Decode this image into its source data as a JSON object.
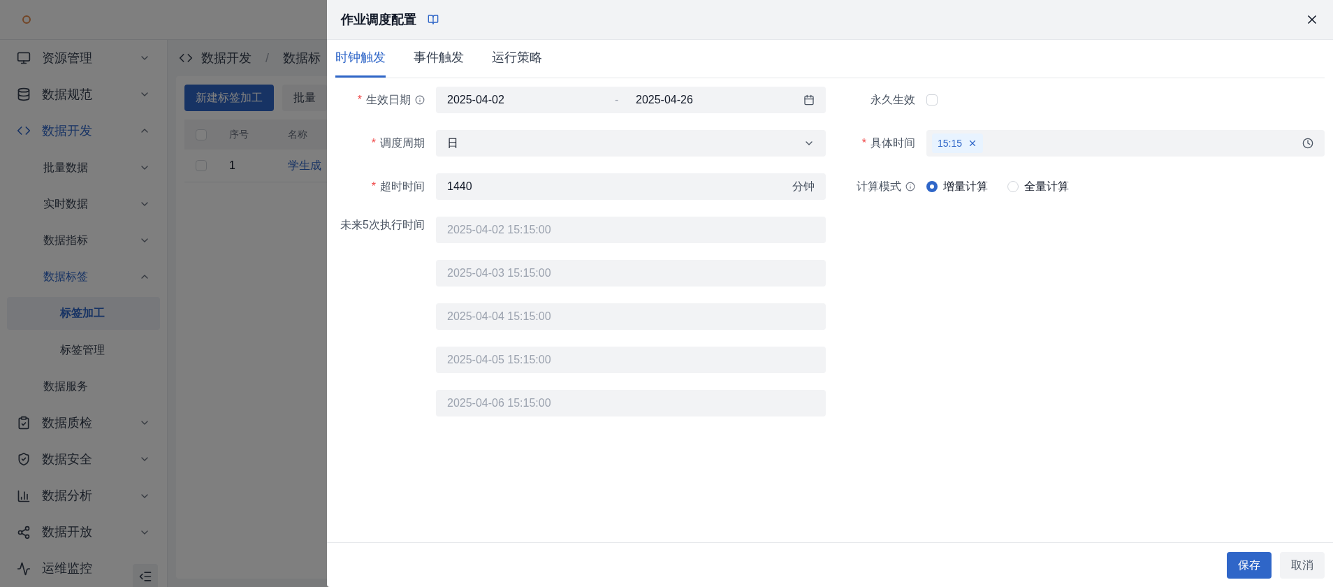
{
  "sidebar": {
    "items": [
      {
        "label": "资源管理",
        "expanded": false,
        "selected": false
      },
      {
        "label": "数据规范",
        "expanded": false,
        "selected": false
      },
      {
        "label": "数据开发",
        "expanded": true,
        "selected": true,
        "children": [
          {
            "label": "批量数据",
            "expanded": false,
            "selected": false,
            "has_children": true
          },
          {
            "label": "实时数据",
            "expanded": false,
            "selected": false,
            "has_children": true
          },
          {
            "label": "数据指标",
            "expanded": false,
            "selected": false,
            "has_children": true
          },
          {
            "label": "数据标签",
            "expanded": true,
            "selected": true,
            "has_children": true,
            "children": [
              {
                "label": "标签加工",
                "selected": true
              },
              {
                "label": "标签管理",
                "selected": false
              }
            ]
          },
          {
            "label": "数据服务",
            "expanded": false,
            "selected": false,
            "has_children": false
          }
        ]
      },
      {
        "label": "数据质检",
        "expanded": false,
        "selected": false
      },
      {
        "label": "数据安全",
        "expanded": false,
        "selected": false
      },
      {
        "label": "数据分析",
        "expanded": false,
        "selected": false
      },
      {
        "label": "数据开放",
        "expanded": false,
        "selected": false
      },
      {
        "label": "运维监控",
        "expanded": false,
        "selected": false
      }
    ]
  },
  "breadcrumb": {
    "items": [
      "数据开发",
      "数据标"
    ],
    "separator": "/"
  },
  "toolbar": [
    "新建标签加工",
    "批量"
  ],
  "table": {
    "header_checked": false,
    "columns": [
      "序号",
      "名称"
    ],
    "rows": [
      {
        "checked": false,
        "cells": [
          "1",
          "学生成"
        ]
      }
    ]
  },
  "drawer": {
    "title": "作业调度配置",
    "tabs": [
      {
        "label": "时钟触发",
        "selected": true
      },
      {
        "label": "事件触发",
        "selected": false
      },
      {
        "label": "运行策略",
        "selected": false
      }
    ],
    "form": {
      "required_mark": "*",
      "effective_date": {
        "label": "生效日期",
        "required": true,
        "start": "2025-04-02",
        "separator": "-",
        "end": "2025-04-26"
      },
      "permanent": {
        "label": "永久生效",
        "checked": false
      },
      "cycle": {
        "label": "调度周期",
        "required": true,
        "value": "日"
      },
      "specific_time": {
        "label": "具体时间",
        "required": true,
        "tags": [
          "15:15"
        ]
      },
      "timeout": {
        "label": "超时时间",
        "required": true,
        "value": "1440",
        "unit": "分钟"
      },
      "compute_mode": {
        "label": "计算模式",
        "options": [
          {
            "label": "增量计算",
            "selected": true
          },
          {
            "label": "全量计算",
            "selected": false
          }
        ]
      },
      "next_runs": {
        "label": "未来5次执行时间",
        "values": [
          "2025-04-02 15:15:00",
          "2025-04-03 15:15:00",
          "2025-04-04 15:15:00",
          "2025-04-05 15:15:00",
          "2025-04-06 15:15:00"
        ]
      }
    },
    "buttons": [
      {
        "label": "保存",
        "kind": "primary"
      },
      {
        "label": "取消",
        "kind": "secondary"
      }
    ]
  }
}
